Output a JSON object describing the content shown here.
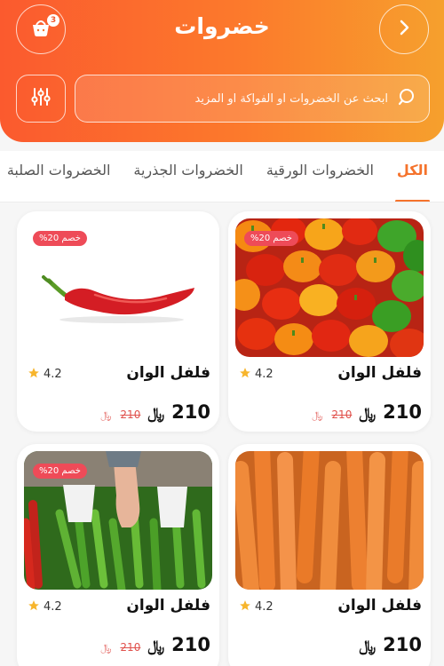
{
  "header": {
    "title": "خضروات",
    "cart_count": "3",
    "search_placeholder": "ابحث عن الخضروات او الفواكة او المزيد"
  },
  "tabs": [
    {
      "label": "الكل",
      "active": true
    },
    {
      "label": "الخضروات الورقية",
      "active": false
    },
    {
      "label": "الخضروات الجذرية",
      "active": false
    },
    {
      "label": "الخضروات الصلبة",
      "active": false
    }
  ],
  "currency_symbol": "﷼",
  "products": [
    {
      "name": "فلفل الوان",
      "rating": "4.2",
      "price": "210",
      "old_price": "210",
      "discount": "خصم 20%",
      "image": "mixed-bell-peppers"
    },
    {
      "name": "فلفل الوان",
      "rating": "4.2",
      "price": "210",
      "old_price": "210",
      "discount": "خصم 20%",
      "image": "red-chili-pepper"
    },
    {
      "name": "فلفل الوان",
      "rating": "4.2",
      "price": "210",
      "old_price": "",
      "discount": "",
      "image": "carrots"
    },
    {
      "name": "فلفل الوان",
      "rating": "4.2",
      "price": "210",
      "old_price": "210",
      "discount": "خصم 20%",
      "image": "green-peppers-market"
    }
  ],
  "colors": {
    "accent": "#f5732c",
    "discount_badge": "#ee4b58",
    "star": "#f7b52c"
  }
}
